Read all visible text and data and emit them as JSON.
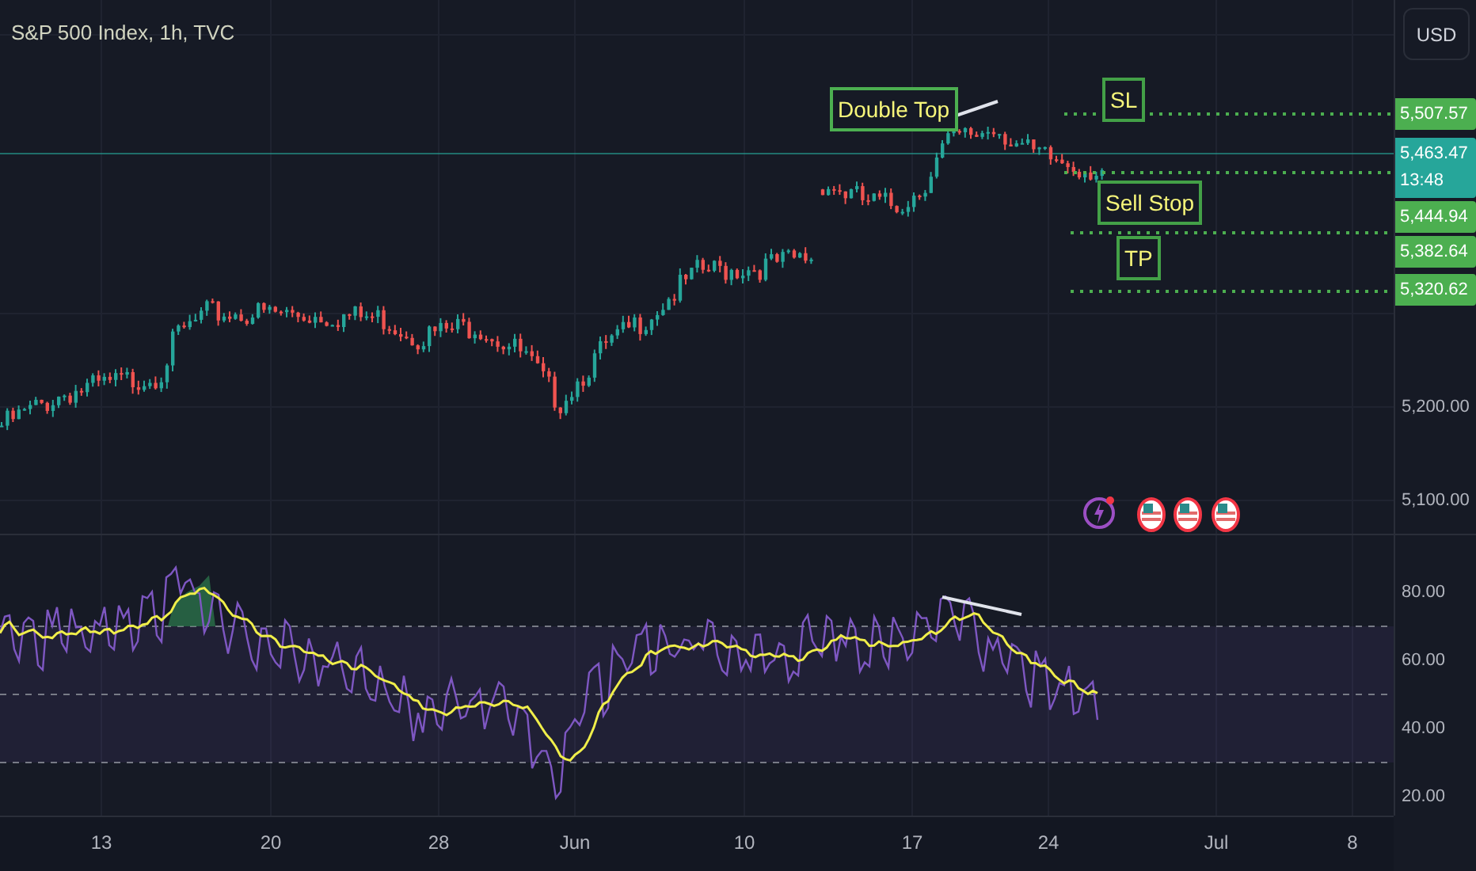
{
  "title": "S&P 500 Index, 1h, TVC",
  "currency_button": "USD",
  "annotations": [
    {
      "kind": "callout",
      "text": "Double Top"
    },
    {
      "kind": "level",
      "text": "SL"
    },
    {
      "kind": "level",
      "text": "Sell Stop"
    },
    {
      "kind": "level",
      "text": "TP"
    }
  ],
  "price_labels": [
    {
      "kind": "level",
      "text": "5,507.57"
    },
    {
      "kind": "current",
      "text": "5,463.47",
      "countdown": "13:48"
    },
    {
      "kind": "level",
      "text": "5,444.94"
    },
    {
      "kind": "level",
      "text": "5,382.64"
    },
    {
      "kind": "level",
      "text": "5,320.62"
    }
  ],
  "price_axis": [
    "5,200.00",
    "5,100.00"
  ],
  "events": [
    {
      "kind": "alert"
    },
    {
      "kind": "flag"
    },
    {
      "kind": "flag"
    },
    {
      "kind": "flag"
    }
  ],
  "rsi_axis": [
    "80.00",
    "60.00",
    "40.00",
    "20.00"
  ],
  "time_axis": [
    "13",
    "20",
    "28",
    "Jun",
    "10",
    "17",
    "24",
    "Jul",
    "8"
  ]
}
